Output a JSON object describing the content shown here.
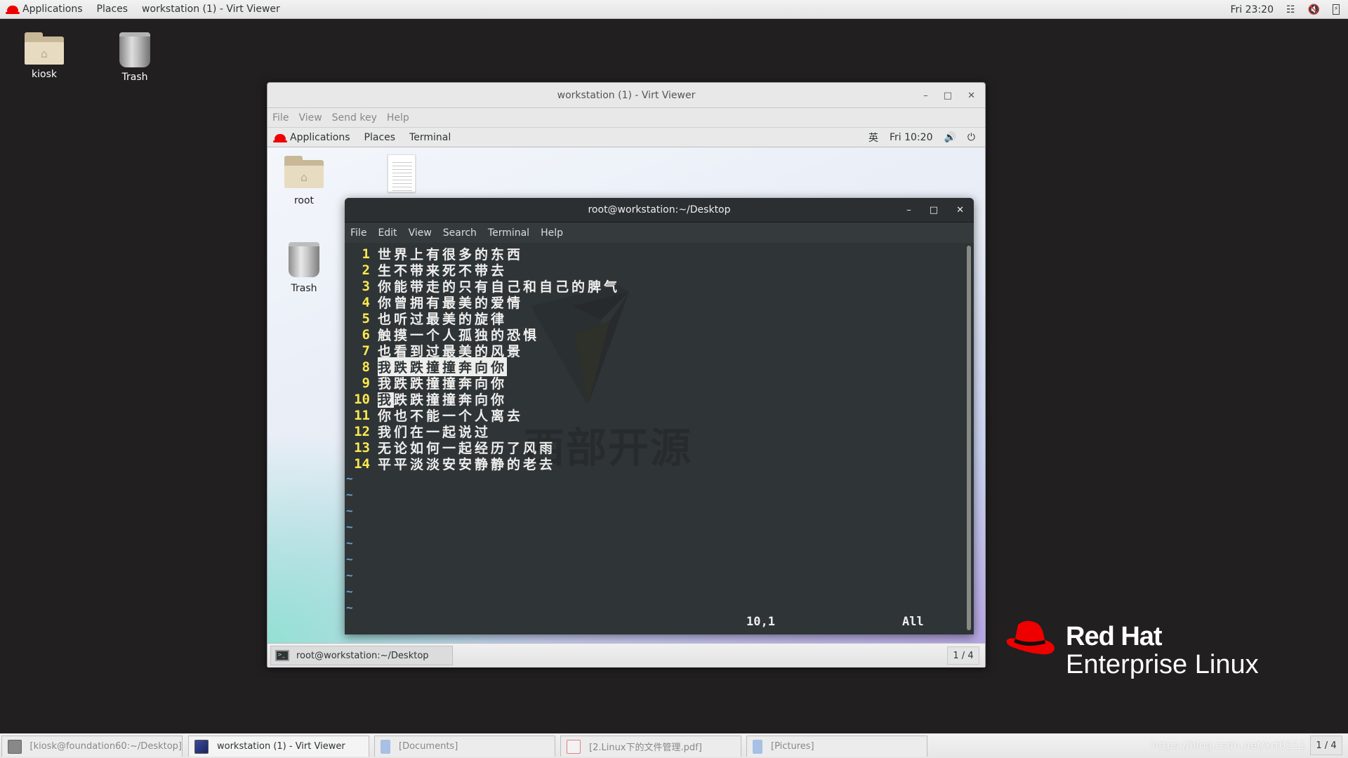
{
  "topbar": {
    "applications": "Applications",
    "places": "Places",
    "window_title": "workstation (1) - Virt Viewer",
    "clock": "Fri 23:20",
    "icons": [
      "network-icon",
      "volume-muted-icon",
      "battery-icon"
    ]
  },
  "desktop": {
    "icons": [
      {
        "label": "kiosk",
        "icon": "home-folder-icon"
      },
      {
        "label": "Trash",
        "icon": "trash-icon"
      }
    ]
  },
  "virt_viewer": {
    "title": "workstation (1) - Virt Viewer",
    "menu": [
      "File",
      "View",
      "Send key",
      "Help"
    ],
    "guest_bar": {
      "applications": "Applications",
      "places": "Places",
      "terminal": "Terminal",
      "input_method": "英",
      "clock": "Fri 10:20"
    },
    "guest_desktop_icons": [
      {
        "label": "root",
        "icon": "home-folder-icon"
      },
      {
        "label": "",
        "icon": "text-document-icon"
      },
      {
        "label": "Trash",
        "icon": "trash-icon"
      }
    ],
    "taskbar": {
      "window_button": "root@workstation:~/Desktop",
      "pager": "1 / 4"
    }
  },
  "terminal": {
    "title": "root@workstation:~/Desktop",
    "menu": [
      "File",
      "Edit",
      "View",
      "Search",
      "Terminal",
      "Help"
    ],
    "lines": [
      {
        "n": "1",
        "text": "世界上有很多的东西"
      },
      {
        "n": "2",
        "text": "生不带来死不带去"
      },
      {
        "n": "3",
        "text": "你能带走的只有自己和自己的脾气"
      },
      {
        "n": "4",
        "text": "你曾拥有最美的爱情"
      },
      {
        "n": "5",
        "text": "也听过最美的旋律"
      },
      {
        "n": "6",
        "text": "触摸一个人孤独的恐惧"
      },
      {
        "n": "7",
        "text": "也看到过最美的风景"
      },
      {
        "n": "8",
        "text": "我跌跌撞撞奔向你"
      },
      {
        "n": "9",
        "text": "我跌跌撞撞奔向你"
      },
      {
        "n": "10",
        "text_cursor": "我",
        "text": "跌跌撞撞奔向你"
      },
      {
        "n": "11",
        "text": "你也不能一个人离去"
      },
      {
        "n": "12",
        "text": "我们在一起说过"
      },
      {
        "n": "13",
        "text": "无论如何一起经历了风雨"
      },
      {
        "n": "14",
        "text": "平平淡淡安安静静的老去"
      }
    ],
    "tilde": "~",
    "highlighted_line": "8",
    "cursor_line": "10",
    "status_position": "10,1",
    "status_scroll": "All",
    "watermark": "西部开源"
  },
  "taskbar": {
    "items": [
      {
        "label": "[kiosk@foundation60:~/Desktop]",
        "icon": "terminal-icon",
        "active": false
      },
      {
        "label": "workstation (1) - Virt Viewer",
        "icon": "virt-viewer-icon",
        "active": true
      },
      {
        "label": "[Documents]",
        "icon": "file-cabinet-icon",
        "active": false
      },
      {
        "label": "[2.Linux下的文件管理.pdf]",
        "icon": "pdf-icon",
        "active": false
      },
      {
        "label": "[Pictures]",
        "icon": "file-cabinet-icon",
        "active": false
      }
    ],
    "pager": "1 / 4",
    "url_watermark": "https://blog.csdn.net/xrt0211"
  },
  "branding": {
    "line1": "Red Hat",
    "line2": "Enterprise Linux",
    "color": "#ee0000"
  }
}
